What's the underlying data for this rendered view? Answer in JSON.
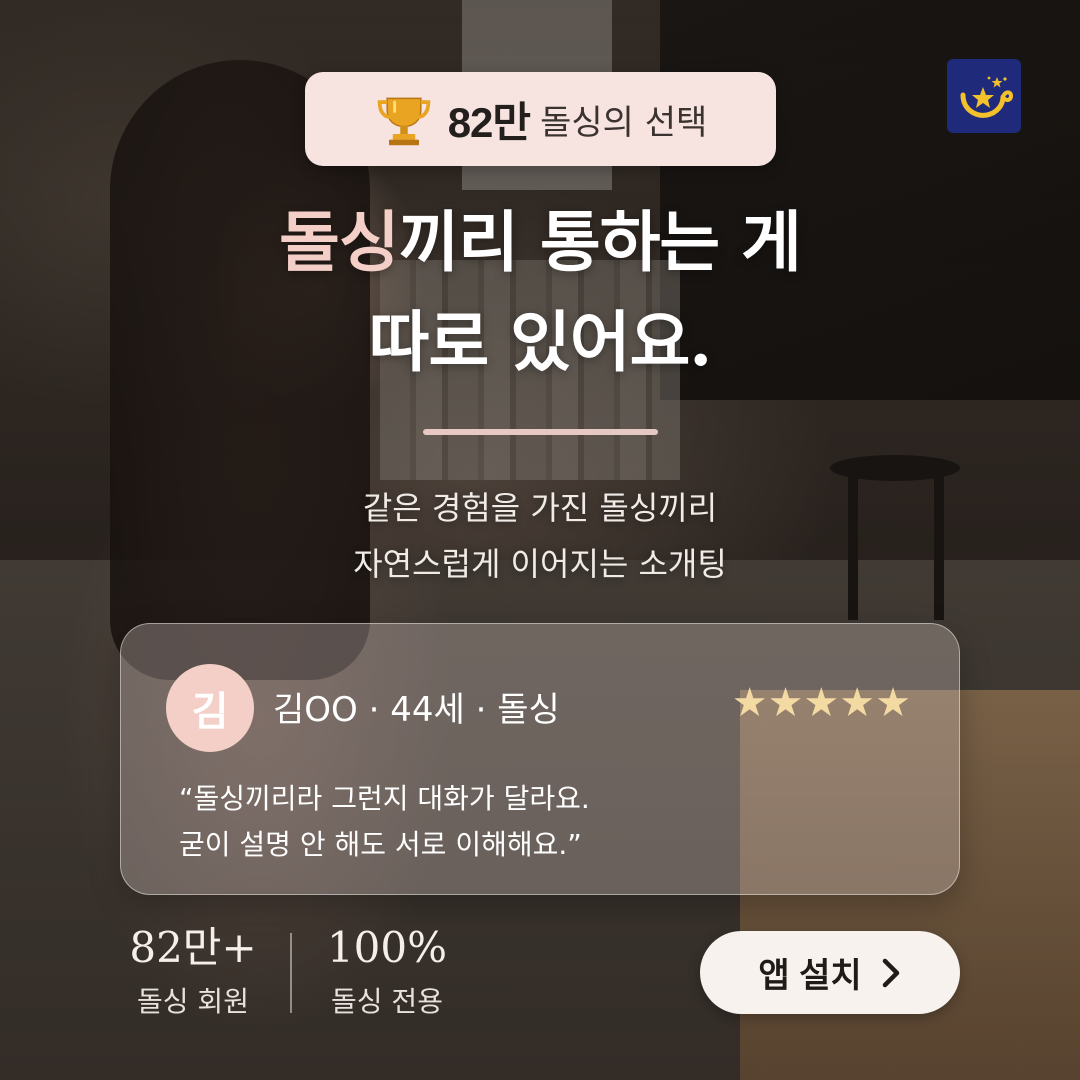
{
  "badge": {
    "icon": "trophy-icon",
    "number": "82만",
    "text": "돌싱의 선택"
  },
  "logo": {
    "icon": "moon-stars-logo",
    "bg_color": "#1f2a7a"
  },
  "headline": {
    "line1_accent": "돌싱",
    "line1_rest": "끼리 통하는 게",
    "line2": "따로 있어요."
  },
  "subtitle": {
    "line1": "같은 경험을 가진 돌싱끼리",
    "line2": "자연스럽게 이어지는 소개팅"
  },
  "review": {
    "avatar_initial": "김",
    "reviewer": "김OO · 44세 · 돌싱",
    "stars": "★★★★★",
    "rating": 5,
    "quote_line1": "“돌싱끼리라 그런지 대화가 달라요.",
    "quote_line2": "굳이 설명 안 해도 서로 이해해요.”"
  },
  "stats": [
    {
      "value": "82만+",
      "label": "돌싱 회원"
    },
    {
      "value": "100%",
      "label": "돌싱 전용"
    }
  ],
  "cta": {
    "label": "앱 설치",
    "icon": "chevron-right-icon"
  },
  "colors": {
    "accent": "#f4cfc8",
    "badge_bg": "#f7e3e0",
    "star": "#f3d9a2",
    "button_bg": "#f7f2ee"
  }
}
